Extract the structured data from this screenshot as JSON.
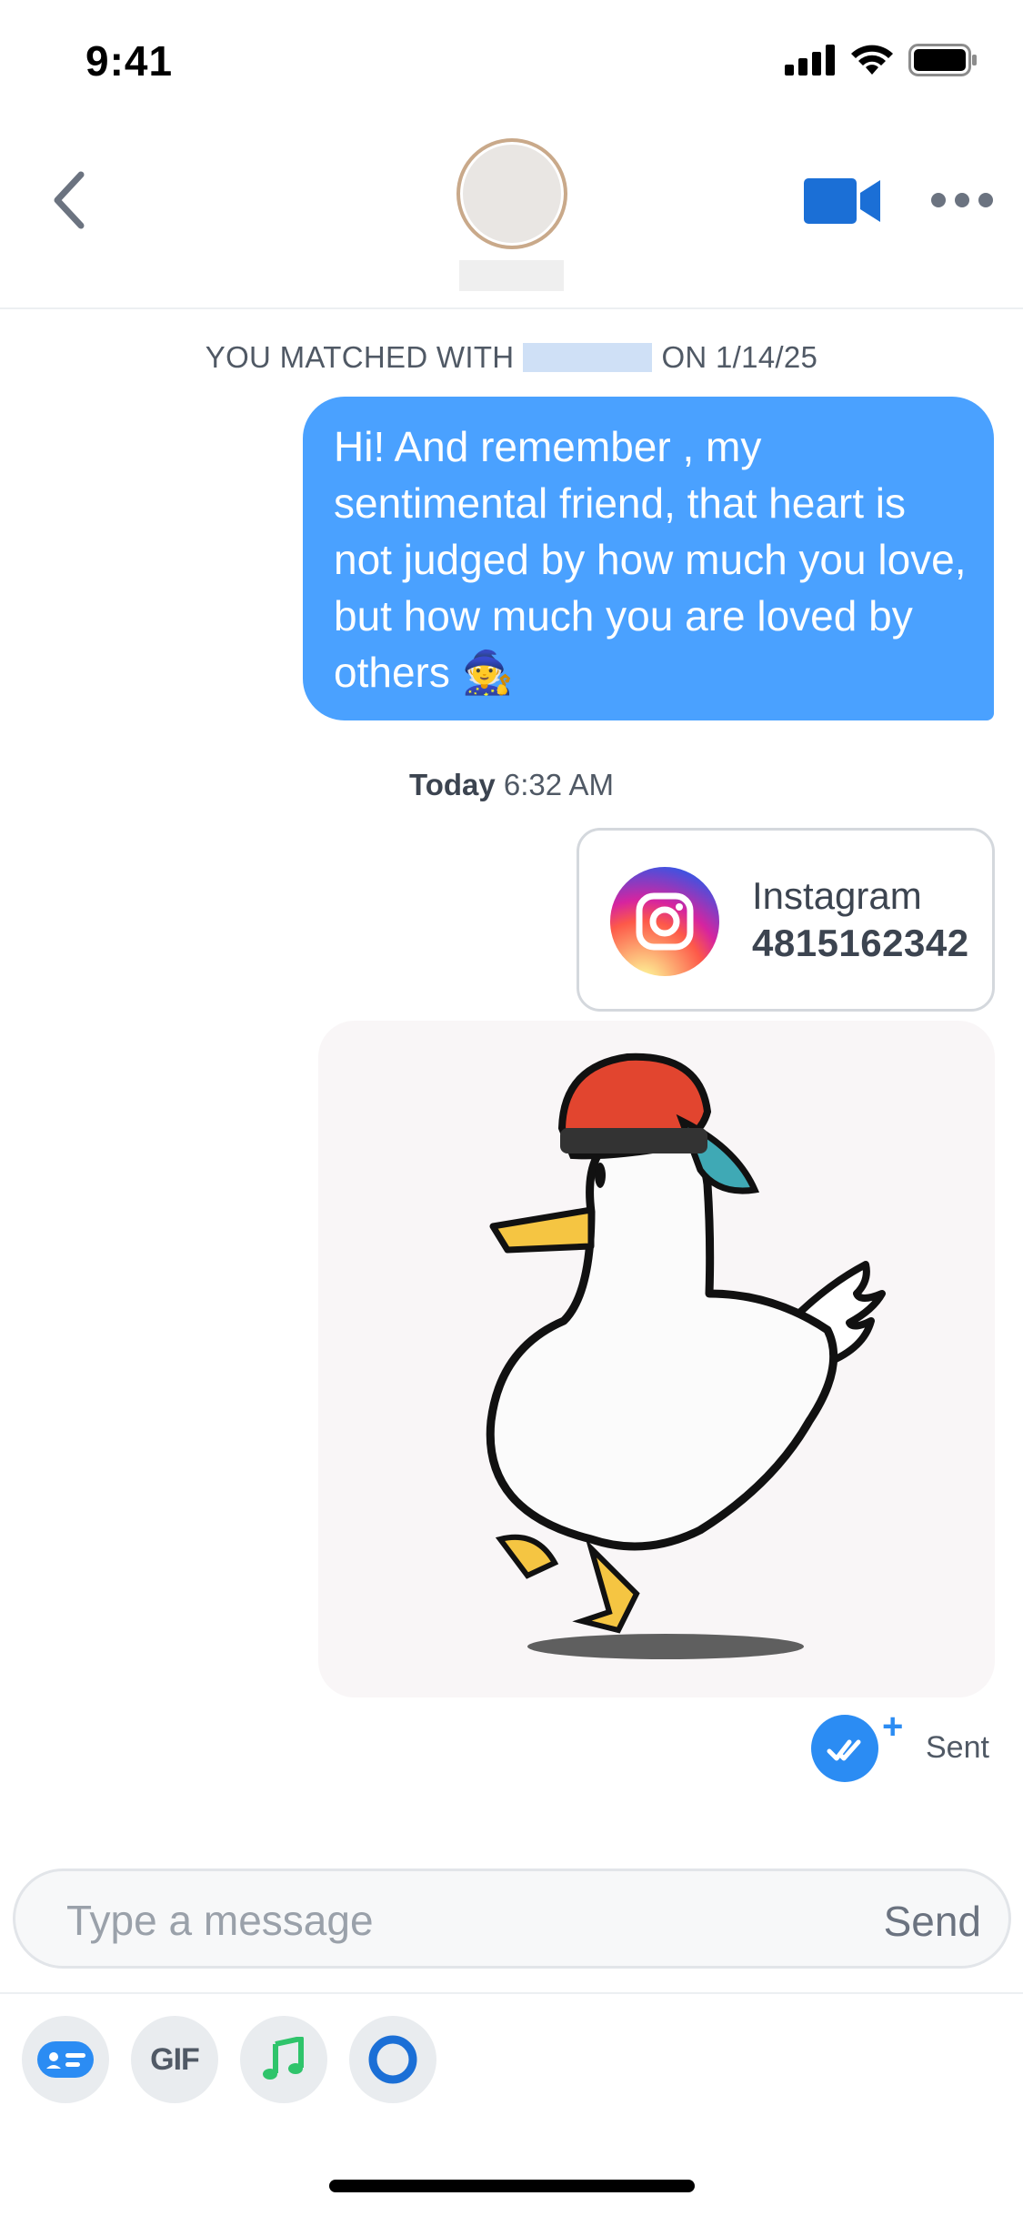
{
  "status_bar": {
    "time": "9:41"
  },
  "header": {
    "avatar_alt": "",
    "actions": [
      "video-call",
      "more"
    ]
  },
  "match_banner": {
    "prefix": "YOU MATCHED WITH",
    "suffix": "ON 1/14/25"
  },
  "messages": [
    {
      "type": "text",
      "text": "Hi! And remember , my sentimental friend, that heart is not judged by how much you love, but how much you are loved by others",
      "emoji": "🧙"
    },
    {
      "type": "instagram_card",
      "label": "Instagram",
      "number": "4815162342"
    },
    {
      "type": "gif",
      "description_icon": "dancing-duck-gif"
    }
  ],
  "timestamp": {
    "day": "Today",
    "time": "6:32 AM"
  },
  "sent_status": {
    "label": "Sent",
    "plus": "+"
  },
  "composer": {
    "placeholder": "Type a message",
    "send_label": "Send"
  },
  "toolbar": {
    "gif_label": "GIF",
    "tools": [
      "sticker-icon",
      "gif-icon",
      "music-icon",
      "loop-icon"
    ]
  },
  "colors": {
    "bubble": "#4aa1ff",
    "accent": "#2b8cf3",
    "video": "#1b6fd6",
    "music": "#2fc46b"
  }
}
